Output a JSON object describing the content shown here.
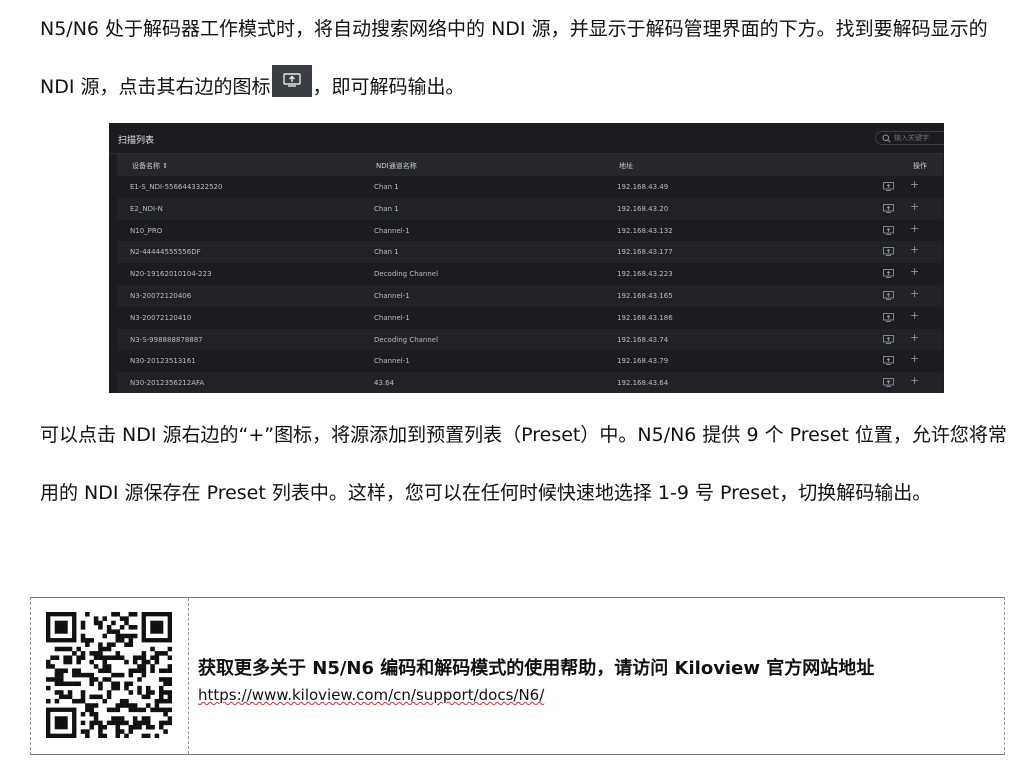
{
  "paragraph1": {
    "part1": "N5/N6 处于解码器工作模式时，将自动搜索网络中的 NDI 源，并显示于解码管理界面的下方。找到要解码显示的 NDI 源，点击其右边的图标",
    "part2": "，即可解码输出。"
  },
  "panel": {
    "title": "扫描列表",
    "search_placeholder": "输入关键字",
    "columns": [
      "设备名称 ⇕",
      "NDI通道名称",
      "地址",
      "操作"
    ],
    "rows": [
      [
        "E1-S_NDI-5566443322520",
        "Chan 1",
        "192.168.43.49"
      ],
      [
        "E2_NDI-N",
        "Chan 1",
        "192.168.43.20"
      ],
      [
        "N10_PRO",
        "Channel-1",
        "192.168.43.132"
      ],
      [
        "N2-44444555556DF",
        "Chan 1",
        "192.168.43.177"
      ],
      [
        "N20-19162010104-223",
        "Decoding Channel",
        "192.168.43.223"
      ],
      [
        "N3-20072120406",
        "Channel-1",
        "192.168.43.165"
      ],
      [
        "N3-20072120410",
        "Channel-1",
        "192.168.43.186"
      ],
      [
        "N3-S-998888878887",
        "Decoding Channel",
        "192.168.43.74"
      ],
      [
        "N30-20123513161",
        "Channel-1",
        "192.168.43.79"
      ],
      [
        "N30-2012356212AFA",
        "43.64",
        "192.168.43.64"
      ]
    ],
    "icons": {
      "search": "search-icon",
      "add": "plus-icon",
      "refresh": "refresh-icon",
      "decode": "screen-output-icon"
    }
  },
  "paragraph2": "可以点击 NDI 源右边的“+”图标，将源添加到预置列表（Preset）中。N5/N6 提供 9 个 Preset 位置，允许您将常用的 NDI 源保存在 Preset 列表中。这样，您可以在任何时候快速地选择 1-9 号 Preset，切换解码输出。",
  "footer": {
    "heading": "获取更多关于 N5/N6 编码和解码模式的使用帮助，请访问 Kiloview 官方网站地址",
    "link": "https://www.kiloview.com/cn/support/docs/N6/"
  }
}
